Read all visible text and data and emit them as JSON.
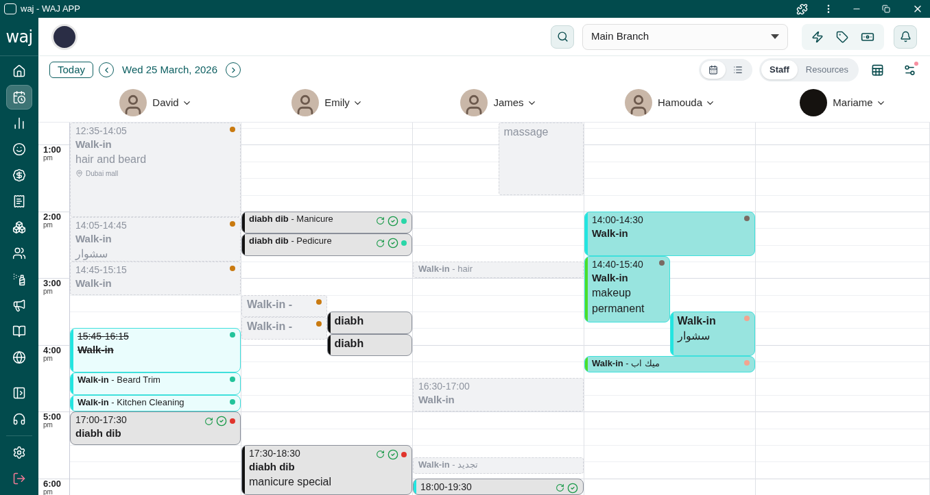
{
  "window": {
    "title": "waj - WAJ APP"
  },
  "sidebar": {
    "logo": "waj",
    "items": [
      {
        "selected": false
      },
      {
        "selected": true
      },
      {
        "selected": false
      },
      {
        "selected": false
      },
      {
        "selected": false
      },
      {
        "selected": false
      },
      {
        "selected": false
      },
      {
        "selected": false
      },
      {
        "selected": false
      },
      {
        "selected": false
      },
      {
        "selected": false
      },
      {
        "selected": false
      }
    ],
    "bottom_items": [
      {
        "selected": false
      },
      {
        "selected": false
      },
      {
        "selected": false
      },
      {
        "selected": false
      }
    ]
  },
  "topbar": {
    "branch": "Main Branch"
  },
  "toolbar": {
    "today": "Today",
    "date": "Wed 25 March, 2026",
    "views": [
      {
        "selected": true
      },
      {
        "selected": false
      }
    ],
    "tabs": [
      {
        "label": "Staff",
        "selected": true
      },
      {
        "label": "Resources",
        "selected": false
      }
    ],
    "filter_badge": true
  },
  "hours": [
    {
      "time": "1:00",
      "period": "pm"
    },
    {
      "time": "2:00",
      "period": "pm"
    },
    {
      "time": "3:00",
      "period": "pm"
    },
    {
      "time": "4:00",
      "period": "pm"
    },
    {
      "time": "5:00",
      "period": "pm"
    },
    {
      "time": "6:00",
      "period": "pm"
    }
  ],
  "columns": [
    {
      "name": "David",
      "kind": "photo",
      "events": [
        {
          "kind": "faded",
          "time": "12:35-14:05",
          "title": "Walk-in",
          "subtitle": "hair and beard",
          "location": "Dubai mall",
          "status_dot": {
            "color": "#c97a10"
          }
        },
        {
          "kind": "faded",
          "time": "14:05-14:45",
          "title": "Walk-in",
          "subtitle": "سشوار",
          "status_dot": {
            "color": "#c97a10"
          }
        },
        {
          "kind": "faded",
          "time": "14:45-15:15",
          "title": "Walk-in",
          "status_dot": {
            "color": "#c97a10"
          }
        },
        {
          "kind": "cyan",
          "time": "15:45-16:15",
          "title": "Walk-in",
          "struck": true,
          "color": "#22e5e0",
          "status_dot": {
            "color": "#22c39a"
          }
        },
        {
          "kind": "cyan",
          "label": "**Walk-in** - Beard Trim",
          "color": "#22e5e0",
          "status_dot": {
            "color": "#22c39a"
          }
        },
        {
          "kind": "cyan",
          "label": "**Walk-in** - Kitchen Cleaning",
          "color": "#22e5e0",
          "status_dot": {
            "color": "#22c39a"
          }
        },
        {
          "kind": "gray",
          "time": "17:00-17:30",
          "title": "diabh dib",
          "actions": true,
          "status_dot": {
            "color": "#e0342c"
          }
        }
      ]
    },
    {
      "name": "Emily",
      "kind": "photo",
      "events": [
        {
          "kind": "gray",
          "label": "**diabh dib**  - Manicure",
          "actions": true,
          "color": "#111111",
          "status_dot": {
            "color": "#2ad6a8"
          }
        },
        {
          "kind": "gray",
          "label": "**diabh dib**  - Pedicure",
          "actions": true,
          "color": "#111111",
          "status_dot": {
            "color": "#2ad6a8"
          }
        },
        {
          "kind": "faded",
          "title": "Walk-in -",
          "status_dot": {
            "color": "#c97a10"
          }
        },
        {
          "kind": "faded",
          "title": "Walk-in -",
          "status_dot": {
            "color": "#c97a10"
          }
        },
        {
          "kind": "gray",
          "title": "diabh",
          "color": "#111111"
        },
        {
          "kind": "gray",
          "title": "diabh",
          "color": "#111111"
        },
        {
          "kind": "gray",
          "time": "17:30-18:30",
          "title": "diabh dib",
          "subtitle": "manicure special",
          "actions": true,
          "color": "#111111",
          "status_dot": {
            "color": "#e0342c"
          }
        }
      ]
    },
    {
      "name": "James",
      "kind": "photo",
      "events": [
        {
          "kind": "faded",
          "subtitle": "massage"
        },
        {
          "kind": "faded",
          "label": "**Walk-in** - hair"
        },
        {
          "kind": "faded",
          "time": "16:30-17:00",
          "title": "Walk-in"
        },
        {
          "kind": "faded",
          "label": "**Walk-in** - تجديد"
        },
        {
          "kind": "gray",
          "time": "18:00-19:30",
          "actions": true,
          "color": "#22e5e0"
        }
      ]
    },
    {
      "name": "Hamouda",
      "kind": "photo",
      "events": [
        {
          "kind": "teal",
          "time": "14:00-14:30",
          "title": "Walk-in",
          "color": "#22e5e0",
          "status_dot": {
            "color": "#7a6a62"
          }
        },
        {
          "kind": "teal",
          "time": "14:40-15:40",
          "title": "Walk-in",
          "subtitle": "makeup permanent",
          "color": "#4ade2a",
          "status_dot": {
            "color": "#7a6a62"
          }
        },
        {
          "kind": "teal",
          "title": "Walk-in",
          "subtitle": "سشوار",
          "color": "#22e5e0",
          "status_dot": {
            "color": "#f2a490"
          }
        },
        {
          "kind": "teal",
          "label": "**Walk-in** - ميك اب",
          "color": "#4ade2a",
          "status_dot": {
            "color": "#f2a490"
          }
        }
      ]
    },
    {
      "name": "Mariame",
      "kind": "dark"
    }
  ]
}
